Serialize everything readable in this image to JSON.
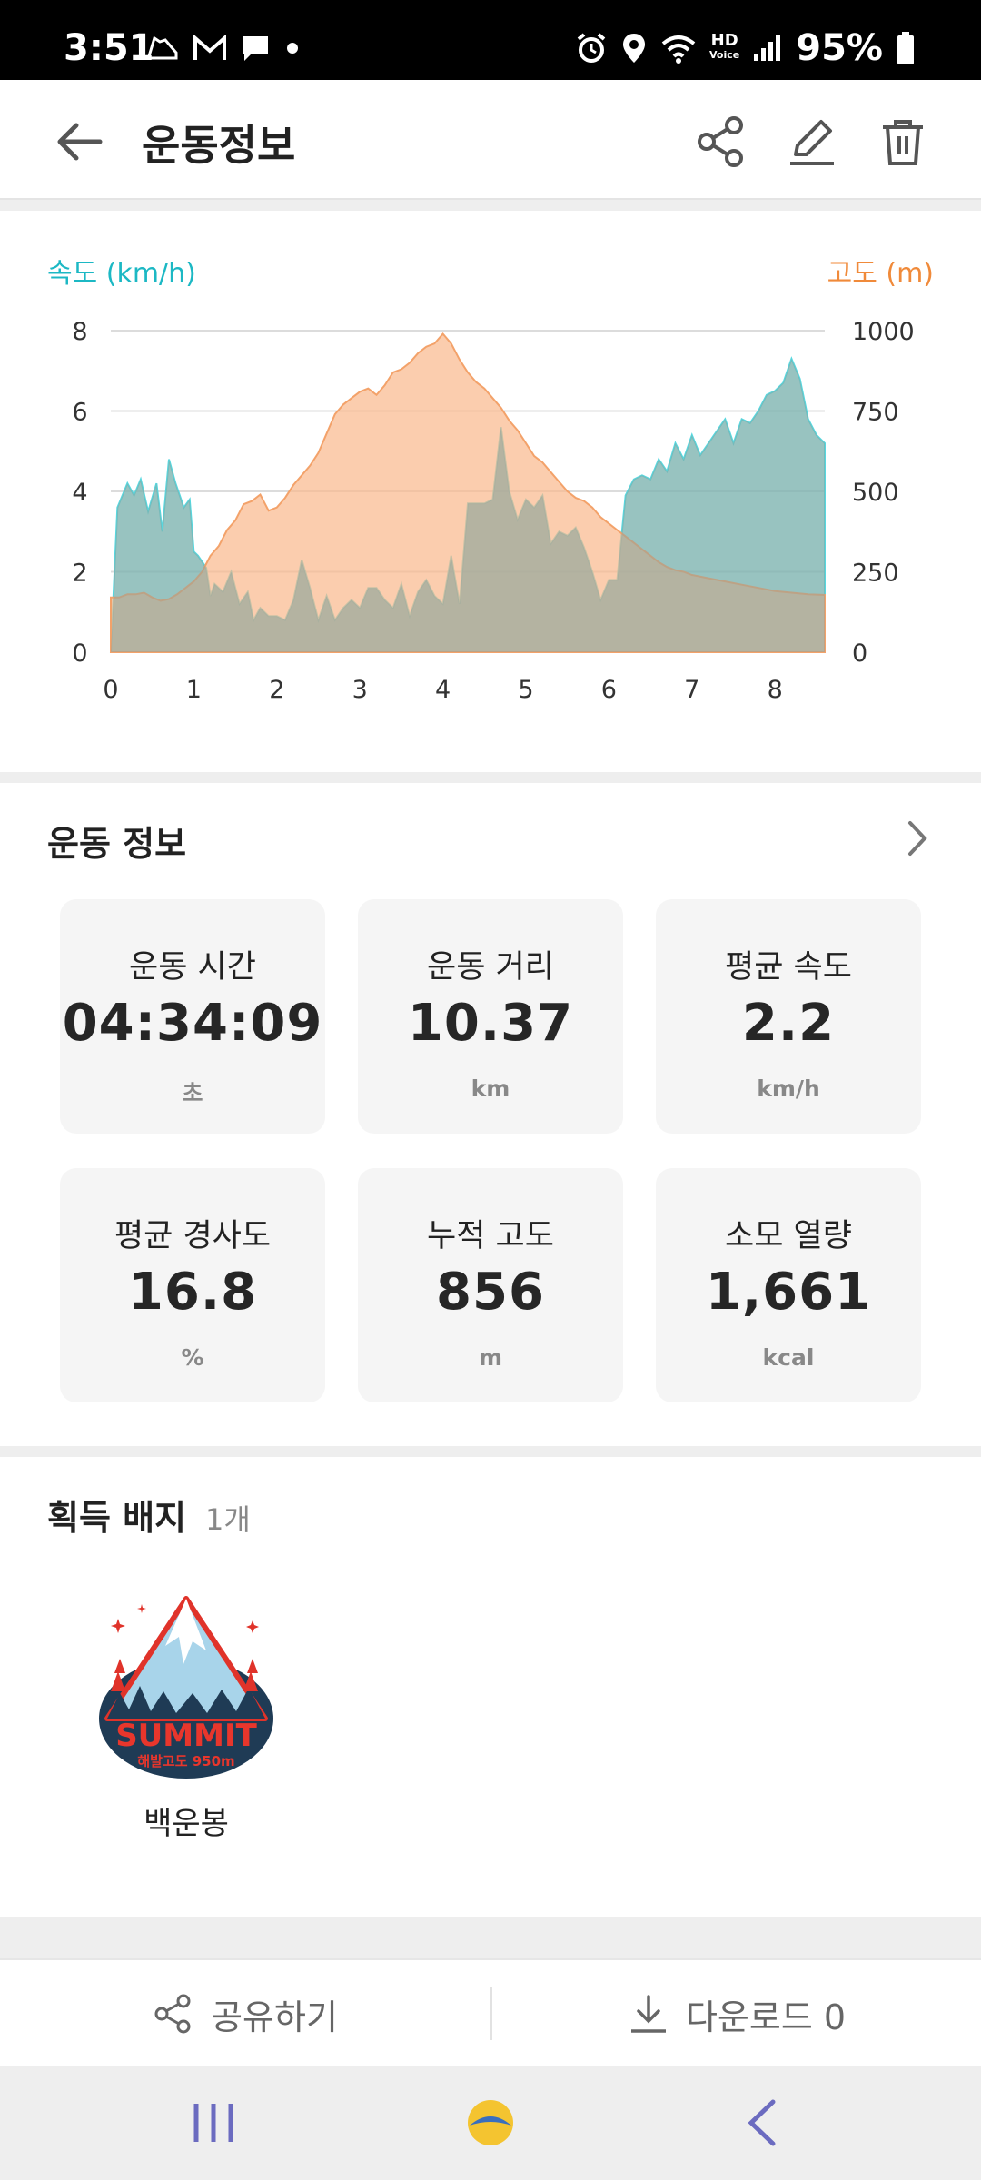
{
  "status_bar": {
    "time": "3:51",
    "battery": "95%",
    "hd_label": "HD",
    "hd_sub": "Voice",
    "icons_left": [
      "shoe-notification-icon",
      "gmail-icon",
      "message-icon",
      "dot-icon"
    ],
    "icons_right": [
      "alarm-icon",
      "location-icon",
      "wifi-icon",
      "hd-voice-icon",
      "signal-icon",
      "battery-icon"
    ]
  },
  "app_bar": {
    "title": "운동정보",
    "actions": [
      "share-icon",
      "edit-icon",
      "delete-icon"
    ]
  },
  "chart_data": {
    "type": "area",
    "xlabel": "",
    "xticks": [
      "0",
      "1",
      "2",
      "3",
      "4",
      "5",
      "6",
      "7",
      "8"
    ],
    "xlim": [
      0,
      8.6
    ],
    "y_left": {
      "label": "속도 (km/h)",
      "ticks": [
        "8",
        "6",
        "4",
        "2",
        "0"
      ],
      "lim": [
        0,
        8
      ],
      "color": "#56d8e0"
    },
    "y_right": {
      "label": "고도 (m)",
      "ticks": [
        "1000",
        "750",
        "500",
        "250",
        "0"
      ],
      "lim": [
        0,
        1000
      ],
      "color": "#f9b88c"
    },
    "series": [
      {
        "name": "속도 (km/h)",
        "axis": "left",
        "x": [
          0,
          0.08,
          0.2,
          0.28,
          0.36,
          0.45,
          0.55,
          0.62,
          0.7,
          0.78,
          0.88,
          0.95,
          1.0,
          1.05,
          1.15,
          1.2,
          1.25,
          1.35,
          1.45,
          1.55,
          1.65,
          1.72,
          1.8,
          1.9,
          2.0,
          2.1,
          2.2,
          2.3,
          2.4,
          2.5,
          2.6,
          2.7,
          2.8,
          2.9,
          3.0,
          3.1,
          3.2,
          3.3,
          3.4,
          3.5,
          3.6,
          3.7,
          3.8,
          3.9,
          4.0,
          4.1,
          4.2,
          4.3,
          4.4,
          4.5,
          4.6,
          4.7,
          4.8,
          4.9,
          5.0,
          5.1,
          5.2,
          5.3,
          5.4,
          5.5,
          5.6,
          5.7,
          5.8,
          5.9,
          6.0,
          6.1,
          6.2,
          6.3,
          6.4,
          6.5,
          6.6,
          6.7,
          6.8,
          6.9,
          7.0,
          7.1,
          7.2,
          7.3,
          7.4,
          7.5,
          7.6,
          7.7,
          7.8,
          7.9,
          8.0,
          8.1,
          8.2,
          8.3,
          8.4,
          8.5,
          8.6
        ],
        "values": [
          0.0,
          3.6,
          4.2,
          3.9,
          4.3,
          3.5,
          4.2,
          3.0,
          4.8,
          4.2,
          3.6,
          3.8,
          2.5,
          2.4,
          2.1,
          1.4,
          1.7,
          1.5,
          2.0,
          1.2,
          1.5,
          0.8,
          1.1,
          0.9,
          0.9,
          0.8,
          1.3,
          2.3,
          1.6,
          0.8,
          1.4,
          0.8,
          1.1,
          1.3,
          1.1,
          1.6,
          1.6,
          1.3,
          1.1,
          1.7,
          0.9,
          1.5,
          1.8,
          1.4,
          1.2,
          2.4,
          1.2,
          3.7,
          3.7,
          3.7,
          3.8,
          5.6,
          4.0,
          3.3,
          3.8,
          3.6,
          3.9,
          2.7,
          3.0,
          2.9,
          3.1,
          2.6,
          2.0,
          1.3,
          1.8,
          1.8,
          3.9,
          4.3,
          4.4,
          4.3,
          4.8,
          4.5,
          5.2,
          4.8,
          5.4,
          4.9,
          5.2,
          5.5,
          5.8,
          5.2,
          5.8,
          5.7,
          6.0,
          6.4,
          6.5,
          6.7,
          7.3,
          6.8,
          5.8,
          5.4,
          5.2
        ]
      },
      {
        "name": "고도 (m)",
        "axis": "right",
        "x": [
          0,
          0.1,
          0.2,
          0.3,
          0.4,
          0.5,
          0.6,
          0.7,
          0.8,
          0.9,
          1.0,
          1.1,
          1.2,
          1.3,
          1.4,
          1.5,
          1.6,
          1.7,
          1.8,
          1.9,
          2.0,
          2.1,
          2.2,
          2.3,
          2.4,
          2.5,
          2.6,
          2.7,
          2.8,
          2.9,
          3.0,
          3.1,
          3.2,
          3.3,
          3.4,
          3.5,
          3.6,
          3.7,
          3.8,
          3.9,
          4.0,
          4.1,
          4.2,
          4.3,
          4.4,
          4.5,
          4.6,
          4.7,
          4.8,
          4.9,
          5.0,
          5.1,
          5.2,
          5.3,
          5.4,
          5.5,
          5.6,
          5.7,
          5.8,
          5.9,
          6.0,
          6.1,
          6.2,
          6.3,
          6.4,
          6.5,
          6.6,
          6.7,
          6.8,
          6.9,
          7.0,
          7.2,
          7.4,
          7.6,
          7.8,
          8.0,
          8.2,
          8.4,
          8.6
        ],
        "values": [
          170,
          170,
          180,
          180,
          185,
          170,
          160,
          165,
          180,
          200,
          220,
          250,
          300,
          330,
          380,
          410,
          460,
          470,
          490,
          440,
          450,
          480,
          520,
          550,
          580,
          620,
          680,
          740,
          770,
          790,
          810,
          820,
          800,
          830,
          870,
          880,
          900,
          930,
          950,
          960,
          990,
          960,
          910,
          870,
          840,
          820,
          790,
          760,
          720,
          690,
          650,
          610,
          590,
          560,
          530,
          500,
          480,
          470,
          450,
          420,
          400,
          380,
          360,
          340,
          320,
          300,
          280,
          265,
          255,
          250,
          240,
          230,
          220,
          210,
          200,
          190,
          185,
          180,
          178
        ]
      }
    ]
  },
  "workout_info": {
    "title": "운동 정보",
    "stats": [
      {
        "label": "운동 시간",
        "value": "04:34:09",
        "unit": "초"
      },
      {
        "label": "운동 거리",
        "value": "10.37",
        "unit": "km"
      },
      {
        "label": "평균 속도",
        "value": "2.2",
        "unit": "km/h"
      },
      {
        "label": "평균 경사도",
        "value": "16.8",
        "unit": "%"
      },
      {
        "label": "누적 고도",
        "value": "856",
        "unit": "m"
      },
      {
        "label": "소모 열량",
        "value": "1,661",
        "unit": "kcal"
      }
    ]
  },
  "badges": {
    "title": "획득 배지",
    "count": "1개",
    "items": [
      {
        "name": "백운봉",
        "emblem_text": "SUMMIT",
        "emblem_sub": "해발고도 950m"
      }
    ]
  },
  "actions": {
    "share": "공유하기",
    "download": "다운로드 0"
  },
  "colors": {
    "speed": "#56d8e0",
    "altitude": "#f9b88c",
    "overlap": "#c2b89c",
    "speed_label": "#1cb8c4",
    "altitude_label": "#f08a3a",
    "nav": "#6b6bc0"
  }
}
